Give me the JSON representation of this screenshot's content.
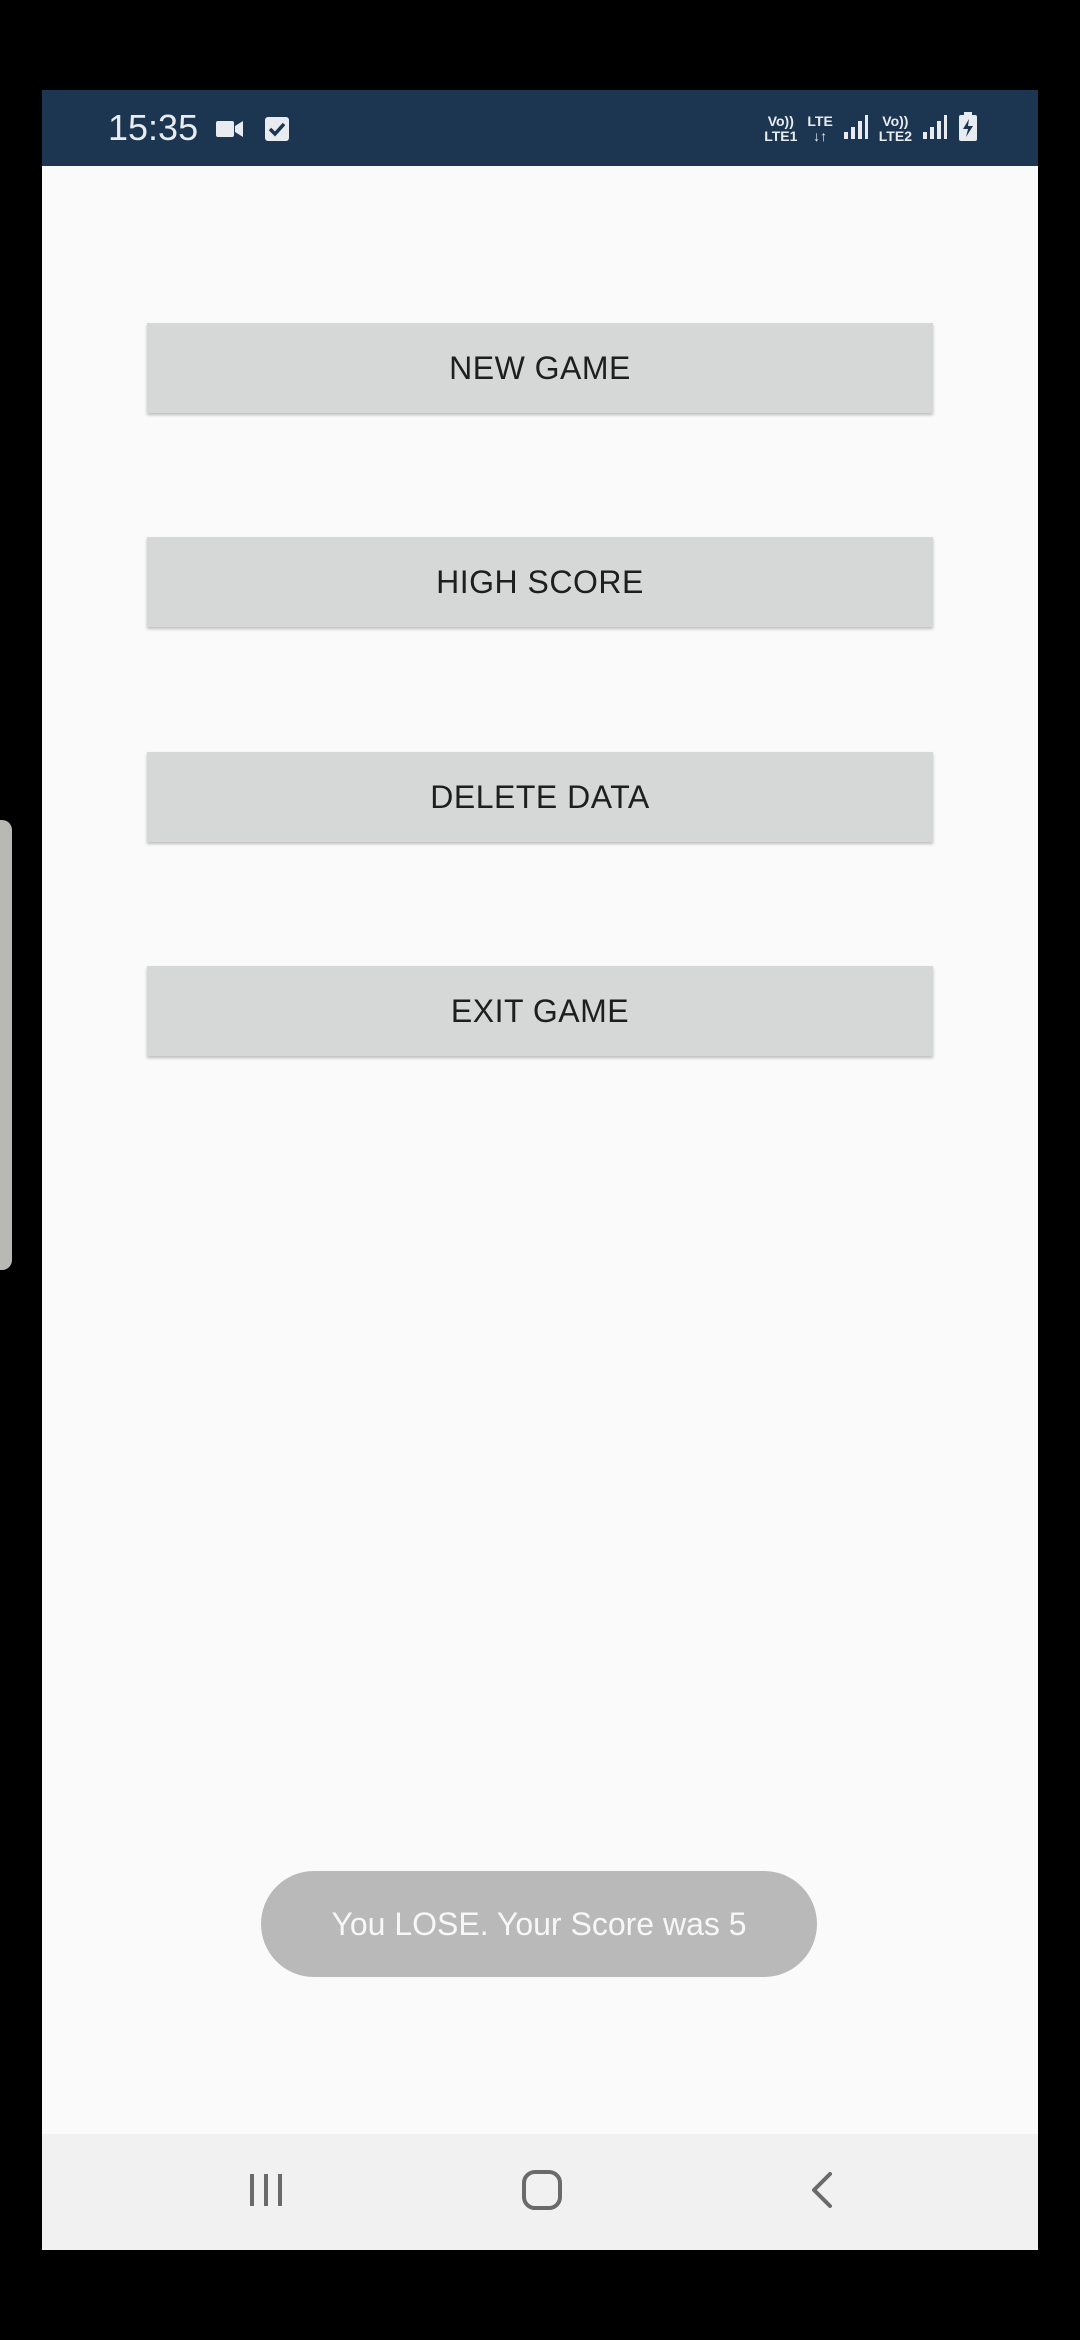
{
  "status_bar": {
    "time": "15:35",
    "icons": [
      "video-camera-icon",
      "checkbox-icon",
      "volte-lte1-icon",
      "lte-data-icon",
      "signal-bars-icon",
      "volte-lte2-icon",
      "signal-bars-icon",
      "battery-charging-icon"
    ],
    "lte1_top": "Vo))",
    "lte1_bottom": "LTE1",
    "lte_top": "LTE",
    "lte2_top": "Vo))",
    "lte2_bottom": "LTE2",
    "background_color": "#1c3550"
  },
  "menu": {
    "buttons": [
      {
        "label": "NEW GAME"
      },
      {
        "label": "HIGH SCORE"
      },
      {
        "label": "DELETE DATA"
      },
      {
        "label": "EXIT GAME"
      }
    ]
  },
  "toast": {
    "message": "You LOSE. Your Score was 5"
  },
  "nav_bar": {
    "icons": [
      "recent-apps-icon",
      "home-icon",
      "back-icon"
    ]
  }
}
